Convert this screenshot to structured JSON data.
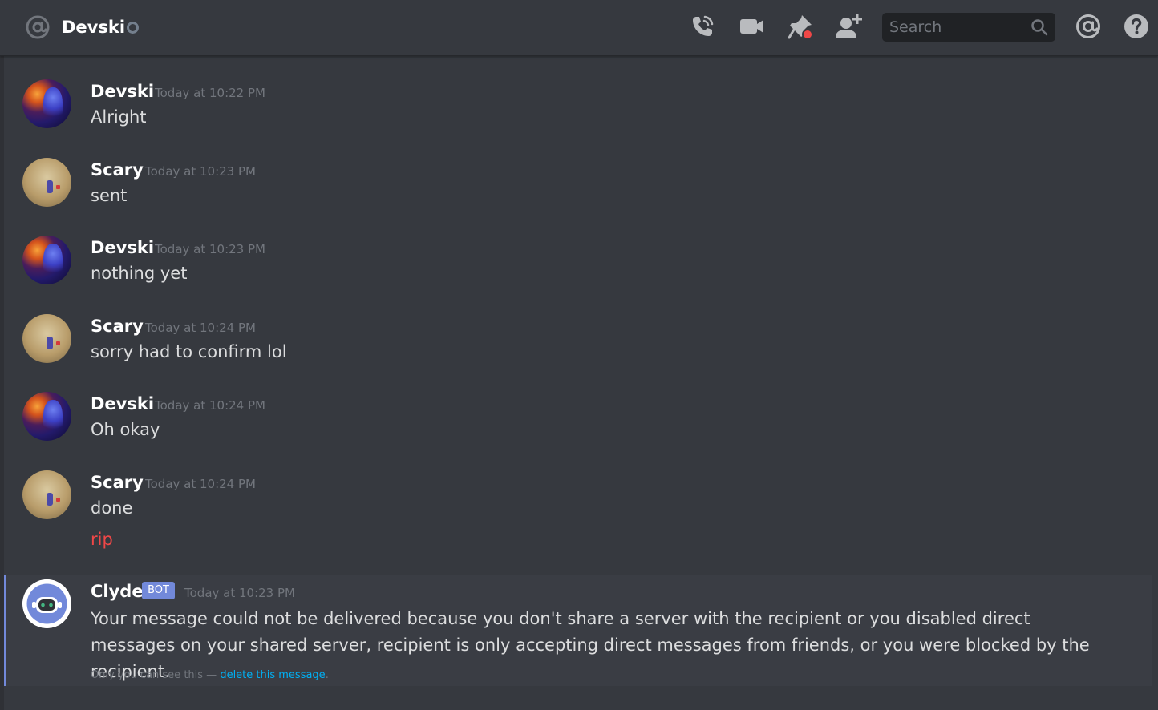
{
  "header": {
    "channel_name": "Devski",
    "search_placeholder": "Search",
    "icons": [
      "at-sign-icon",
      "status-offline-icon",
      "call-icon",
      "video-icon",
      "pin-icon",
      "add-user-icon",
      "search-icon",
      "mentions-icon",
      "help-icon"
    ]
  },
  "messages": [
    {
      "username": "Devski",
      "timestamp": "Today at 10:22 PM",
      "text": "Alright"
    },
    {
      "username": "Scary",
      "timestamp": "Today at 10:23 PM",
      "text": "sent"
    },
    {
      "username": "Devski",
      "timestamp": "Today at 10:23 PM",
      "text": "nothing yet"
    },
    {
      "username": "Scary",
      "timestamp": "Today at 10:24 PM",
      "text": "sorry had to confirm lol"
    },
    {
      "username": "Devski",
      "timestamp": "Today at 10:24 PM",
      "text": "Oh okay"
    },
    {
      "username": "Scary",
      "timestamp": "Today at 10:24 PM",
      "text": "done",
      "failed_text": "rip"
    }
  ],
  "clyde": {
    "username": "Clyde",
    "badge": "BOT",
    "timestamp": "Today at 10:23 PM",
    "text": "Your message could not be delivered because you don't share a server with the recipient or you disabled direct messages on your shared server, recipient is only accepting direct messages from friends, or you were blocked by the recipient.",
    "note_prefix": "Only you can see this — ",
    "note_link": "delete this message",
    "note_suffix": "."
  },
  "colors": {
    "background": "#36393f",
    "header_bg": "#36393f",
    "search_bg": "#202225",
    "accent_blurple": "#7289da",
    "error_red": "#f04747",
    "link_blue": "#00b0f4",
    "muted_text": "#72767d",
    "icon_gray": "#b9bbbe"
  }
}
